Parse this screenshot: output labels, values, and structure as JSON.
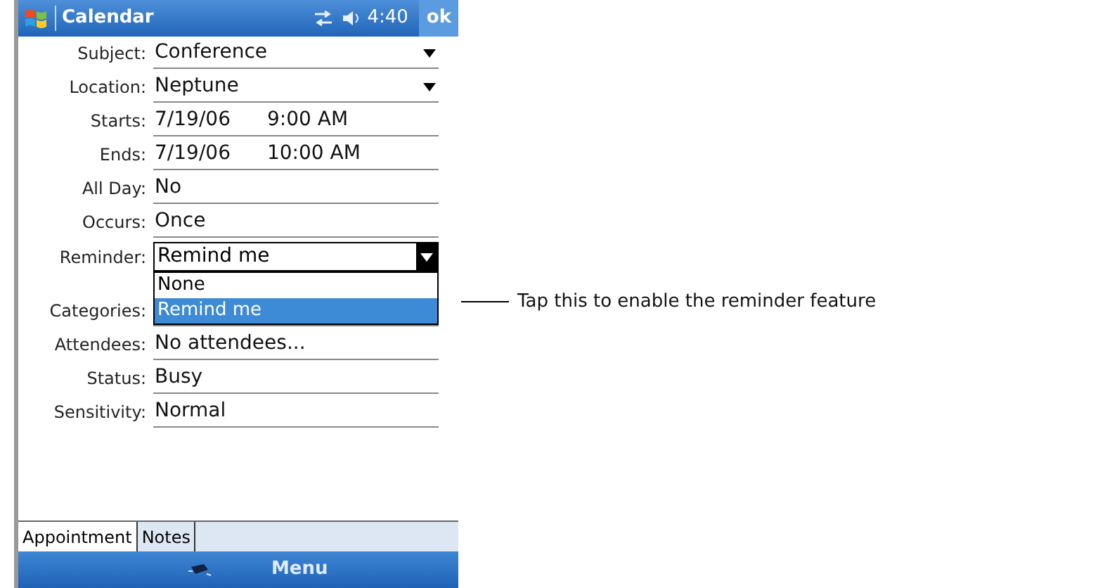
{
  "title_bar": {
    "title": "Calendar",
    "time": "4:40",
    "ok": "ok"
  },
  "fields": [
    {
      "label": "Subject:",
      "kind": "dropdown",
      "value": "Conference"
    },
    {
      "label": "Location:",
      "kind": "dropdown",
      "value": "Neptune"
    },
    {
      "label": "Starts:",
      "kind": "datetime",
      "value": "7/19/06",
      "time": "9:00 AM"
    },
    {
      "label": "Ends:",
      "kind": "datetime",
      "value": "7/19/06",
      "time": "10:00 AM"
    },
    {
      "label": "All Day:",
      "kind": "text",
      "value": "No"
    },
    {
      "label": "Occurs:",
      "kind": "text",
      "value": "Once"
    },
    {
      "label": "Reminder:",
      "kind": "combo",
      "value": "Remind me",
      "expanded": true,
      "options": [
        {
          "label": "None",
          "selected": false
        },
        {
          "label": "Remind me",
          "selected": true
        }
      ]
    },
    {
      "label": "Categories:",
      "kind": "text"
    },
    {
      "label": "Attendees:",
      "kind": "text",
      "value": "No attendees..."
    },
    {
      "label": "Status:",
      "kind": "text",
      "value": "Busy"
    },
    {
      "label": "Sensitivity:",
      "kind": "text",
      "value": "Normal"
    }
  ],
  "tabs": [
    {
      "label": "Appointment",
      "selected": true
    },
    {
      "label": "Notes",
      "selected": false
    }
  ],
  "menu_bar": {
    "menu": "Menu"
  },
  "callout": "Tap this to enable the reminder feature"
}
